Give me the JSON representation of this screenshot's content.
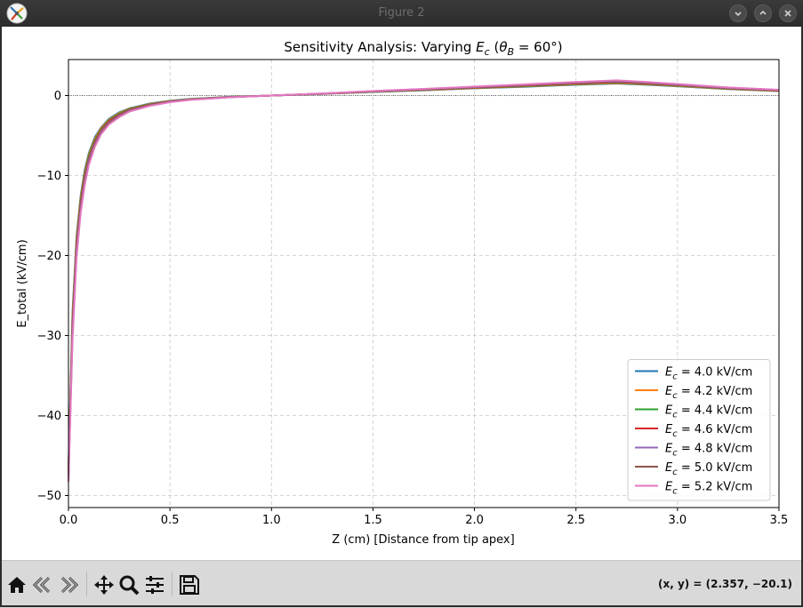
{
  "window": {
    "title": "Figure 2",
    "icon": "matplotlib-logo-icon",
    "controls": [
      "minimize-icon",
      "maximize-icon",
      "close-icon"
    ]
  },
  "toolbar": {
    "tools": [
      "home-icon",
      "back-arrow-icon",
      "forward-arrow-icon",
      "pan-icon",
      "zoom-icon",
      "configure-subplots-icon",
      "save-icon"
    ],
    "coords": "(x, y) = (2.357, −20.1)"
  },
  "chart_data": {
    "type": "line",
    "title_prefix": "Sensitivity Analysis: Varying ",
    "title_symbol": "E",
    "title_symbol_sub": "c",
    "title_paren_open": " (",
    "title_theta": "θ",
    "title_theta_sub": "B",
    "title_rest": " = 60°)",
    "xlabel": "Z (cm) [Distance from tip apex]",
    "ylabel": "E_total (kV/cm)",
    "xlim": [
      0.0,
      3.5
    ],
    "ylim": [
      -51.5,
      4.5
    ],
    "xticks": [
      0.0,
      0.5,
      1.0,
      1.5,
      2.0,
      2.5,
      3.0,
      3.5
    ],
    "xtick_labels": [
      "0.0",
      "0.5",
      "1.0",
      "1.5",
      "2.0",
      "2.5",
      "3.0",
      "3.5"
    ],
    "yticks": [
      0,
      -10,
      -20,
      -30,
      -40,
      -50
    ],
    "ytick_labels": [
      "0",
      "−10",
      "−20",
      "−30",
      "−40",
      "−50"
    ],
    "grid": true,
    "zero_line": true,
    "legend_position": "lower-right",
    "legend_symbol": "E",
    "legend_symbol_sub": "c",
    "legend_eq": " = ",
    "x": [
      0.0,
      0.02,
      0.04,
      0.06,
      0.08,
      0.1,
      0.13,
      0.16,
      0.2,
      0.25,
      0.3,
      0.4,
      0.5,
      0.6,
      0.8,
      1.0,
      1.25,
      1.5,
      1.75,
      2.0,
      2.25,
      2.5,
      2.7,
      2.85,
      3.0,
      3.25,
      3.5
    ],
    "series": [
      {
        "name": "4.0 kV/cm",
        "color": "#1f77b4",
        "values": [
          -46.5,
          -27.0,
          -17.5,
          -12.5,
          -9.3,
          -7.2,
          -5.2,
          -4.0,
          -2.9,
          -2.1,
          -1.6,
          -1.0,
          -0.65,
          -0.42,
          -0.15,
          0.0,
          0.2,
          0.45,
          0.65,
          0.9,
          1.1,
          1.35,
          1.5,
          1.35,
          1.15,
          0.8,
          0.55
        ]
      },
      {
        "name": "4.2 kV/cm",
        "color": "#ff7f0e",
        "values": [
          -46.8,
          -27.5,
          -17.9,
          -12.8,
          -9.6,
          -7.4,
          -5.4,
          -4.1,
          -3.0,
          -2.2,
          -1.65,
          -1.05,
          -0.68,
          -0.44,
          -0.16,
          0.0,
          0.21,
          0.47,
          0.68,
          0.93,
          1.15,
          1.4,
          1.56,
          1.4,
          1.2,
          0.83,
          0.57
        ]
      },
      {
        "name": "4.4 kV/cm",
        "color": "#2ca02c",
        "values": [
          -47.1,
          -28.0,
          -18.3,
          -13.1,
          -9.9,
          -7.6,
          -5.6,
          -4.25,
          -3.1,
          -2.3,
          -1.7,
          -1.1,
          -0.71,
          -0.46,
          -0.17,
          0.0,
          0.22,
          0.49,
          0.71,
          0.97,
          1.2,
          1.46,
          1.62,
          1.46,
          1.25,
          0.86,
          0.6
        ]
      },
      {
        "name": "4.6 kV/cm",
        "color": "#d62728",
        "values": [
          -47.4,
          -28.6,
          -18.7,
          -13.5,
          -10.2,
          -7.9,
          -5.8,
          -4.4,
          -3.2,
          -2.4,
          -1.78,
          -1.15,
          -0.74,
          -0.48,
          -0.18,
          0.0,
          0.23,
          0.51,
          0.74,
          1.0,
          1.25,
          1.52,
          1.68,
          1.52,
          1.3,
          0.9,
          0.63
        ]
      },
      {
        "name": "4.8 kV/cm",
        "color": "#9467bd",
        "values": [
          -47.7,
          -29.2,
          -19.2,
          -13.9,
          -10.5,
          -8.1,
          -6.0,
          -4.55,
          -3.35,
          -2.5,
          -1.85,
          -1.2,
          -0.77,
          -0.5,
          -0.19,
          0.0,
          0.24,
          0.53,
          0.77,
          1.04,
          1.3,
          1.58,
          1.75,
          1.58,
          1.35,
          0.94,
          0.66
        ]
      },
      {
        "name": "5.0 kV/cm",
        "color": "#8c564b",
        "values": [
          -48.0,
          -29.8,
          -19.7,
          -14.3,
          -10.8,
          -8.4,
          -6.2,
          -4.7,
          -3.45,
          -2.6,
          -1.92,
          -1.25,
          -0.8,
          -0.52,
          -0.2,
          0.0,
          0.25,
          0.55,
          0.8,
          1.08,
          1.35,
          1.64,
          1.82,
          1.64,
          1.4,
          0.98,
          0.69
        ]
      },
      {
        "name": "5.2 kV/cm",
        "color": "#e377c2",
        "values": [
          -48.3,
          -30.5,
          -20.2,
          -14.7,
          -11.2,
          -8.7,
          -6.4,
          -4.85,
          -3.6,
          -2.7,
          -2.0,
          -1.3,
          -0.83,
          -0.54,
          -0.21,
          0.0,
          0.26,
          0.57,
          0.83,
          1.12,
          1.4,
          1.7,
          1.9,
          1.7,
          1.45,
          1.02,
          0.72
        ]
      }
    ]
  }
}
